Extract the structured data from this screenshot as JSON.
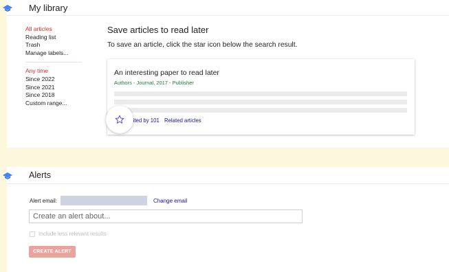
{
  "library": {
    "title": "My library",
    "nav_top": [
      {
        "label": "All articles",
        "active": true
      },
      {
        "label": "Reading list",
        "active": false
      },
      {
        "label": "Trash",
        "active": false
      },
      {
        "label": "Manage labels...",
        "active": false
      }
    ],
    "nav_time": [
      {
        "label": "Any time",
        "active": true
      },
      {
        "label": "Since 2022",
        "active": false
      },
      {
        "label": "Since 2021",
        "active": false
      },
      {
        "label": "Since 2018",
        "active": false
      },
      {
        "label": "Custom range...",
        "active": false
      }
    ],
    "heading": "Save articles to read later",
    "hint": "To save an article, click the star icon below the search result.",
    "result": {
      "title": "An interesting paper to read later",
      "meta": "Authors - Journal, 2017 - Publisher",
      "cited_by": "Cited by 101",
      "related": "Related articles"
    }
  },
  "alerts": {
    "title": "Alerts",
    "email_label": "Alert email:",
    "change_email": "Change email",
    "input_placeholder": "Create an alert about...",
    "checkbox_label": "Include less relevant results",
    "create_button": "CREATE ALERT"
  },
  "colors": {
    "page_bg": "#fdf7de",
    "accent_red": "#d93025",
    "link_blue": "#1a0dab",
    "meta_green": "#1a7d37",
    "icon_blue": "#4285f4",
    "star_purple": "#6f4dc8",
    "button_disabled": "#e8a39c"
  },
  "icons": {
    "header": "graduation-cap-icon",
    "star": "star-outline-icon"
  }
}
